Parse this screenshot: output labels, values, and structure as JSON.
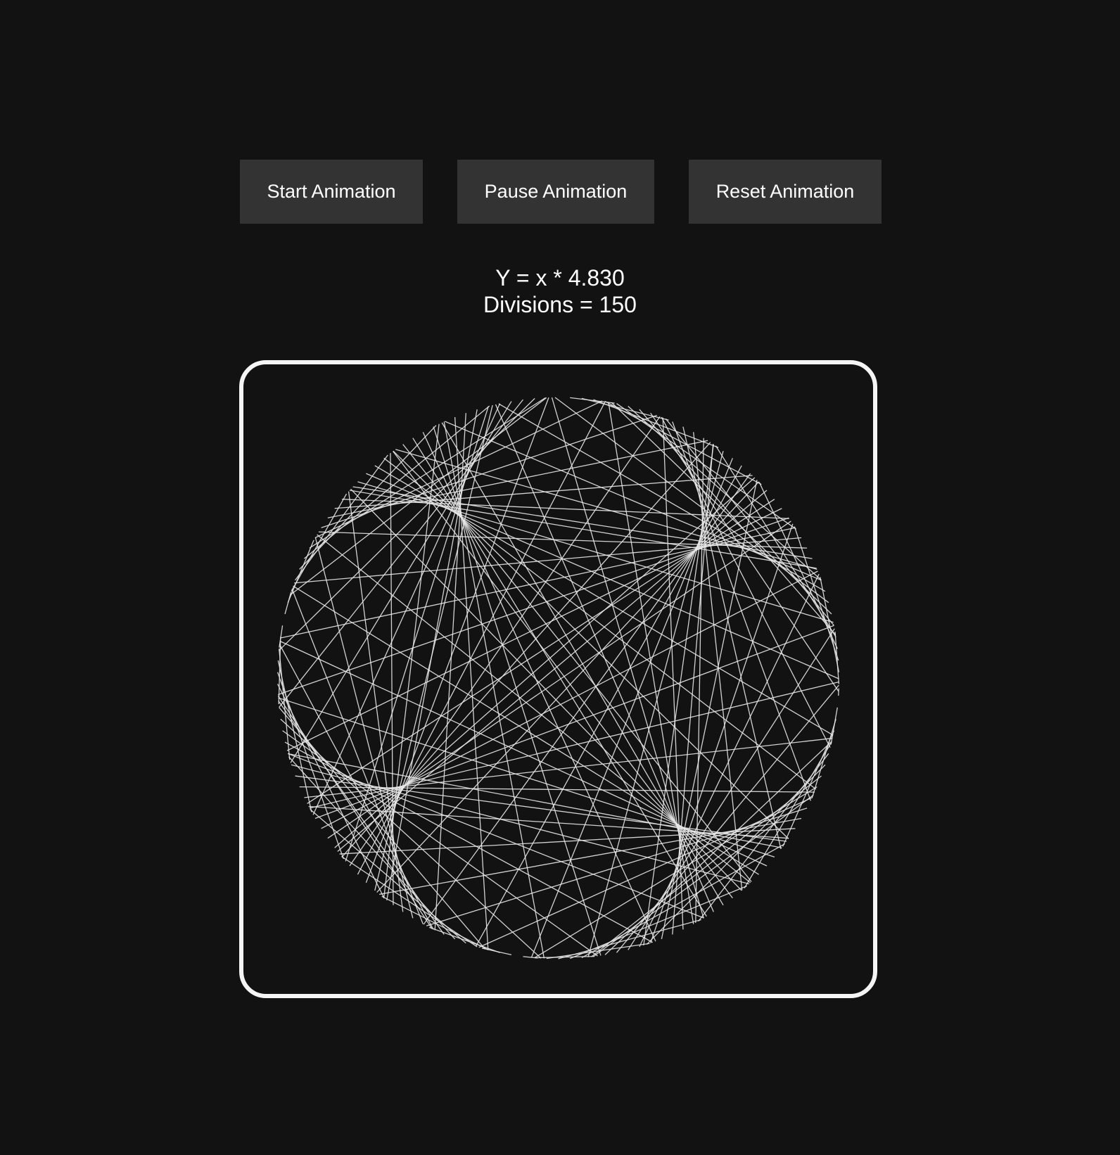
{
  "controls": {
    "start_label": "Start Animation",
    "pause_label": "Pause Animation",
    "reset_label": "Reset Animation"
  },
  "readout": {
    "formula_text": "Y = x * 4.830",
    "divisions_text": "Divisions = 150",
    "multiplier": 4.83,
    "divisions": 150
  },
  "colors": {
    "background": "#121212",
    "button_background": "#333333",
    "text": "#ffffff",
    "frame_border": "#f5f5f5",
    "line": "#e8e8e8"
  }
}
